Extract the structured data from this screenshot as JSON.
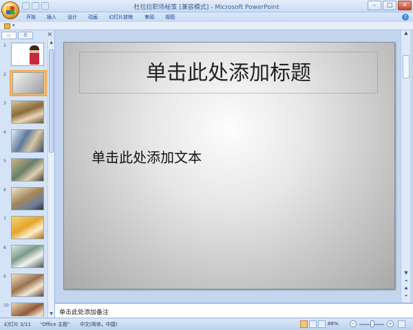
{
  "window": {
    "title": "杜拉拉职场秘笈 [兼容模式] - Microsoft PowerPoint",
    "controls": {
      "minimize": "–",
      "maximize": "□",
      "close": "✕"
    }
  },
  "ribbon": {
    "tabs": [
      "开始",
      "插入",
      "设计",
      "动画",
      "幻灯片放映",
      "审阅",
      "视图"
    ],
    "help": "?"
  },
  "left_panel": {
    "close": "✕",
    "thumbnail_numbers": [
      "1",
      "2",
      "3",
      "4",
      "5",
      "6",
      "7",
      "8",
      "9",
      "10"
    ],
    "selected": 2
  },
  "slide": {
    "title_placeholder": "单击此处添加标题",
    "body_placeholder": "单击此处添加文本"
  },
  "notes": {
    "placeholder": "单击此处添加备注"
  },
  "status": {
    "slide_info": "幻灯片 2/11",
    "theme": "\"Office 主题\"",
    "language": "中文(简体，中国)",
    "zoom": "88%"
  }
}
